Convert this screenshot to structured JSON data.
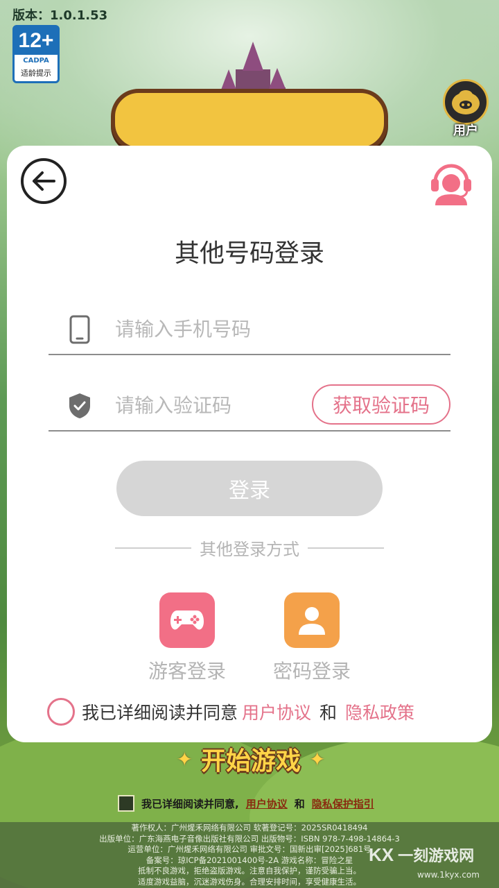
{
  "version": "版本：1.0.1.53",
  "age_badge": {
    "rating": "12+",
    "org": "CADPA",
    "tip": "适龄提示"
  },
  "user_button": {
    "label": "用户"
  },
  "dialog": {
    "title": "其他号码登录",
    "phone_placeholder": "请输入手机号码",
    "code_placeholder": "请输入验证码",
    "get_code_label": "获取验证码",
    "login_label": "登录",
    "other_methods_label": "其他登录方式",
    "guest_login_label": "游客登录",
    "password_login_label": "密码登录",
    "agreement": {
      "prefix": "我已详细阅读并同意",
      "user_agreement": "用户协议",
      "and": "和",
      "privacy_policy": "隐私政策"
    }
  },
  "start_game_label": "开始游戏",
  "bottom_agreement": {
    "prefix": "我已详细阅读并同意,",
    "user_agreement": "用户协议",
    "and": "和",
    "privacy_guide": "隐私保护指引"
  },
  "legal": [
    "著作权人：广州煋禾网络有限公司 软著登记号：2025SR0418494",
    "出版单位：广东海燕电子音像出版社有限公司 出版物号：ISBN 978-7-498-14864-3",
    "运营单位：广州煋禾网络有限公司 审批文号：国新出审[2025]681号",
    "备案号：琼ICP备2021001400号-2A 游戏名称：冒险之星",
    "抵制不良游戏，拒绝盗版游戏。注意自我保护，谨防受骗上当。",
    "适度游戏益脑，沉迷游戏伤身。合理安排时间，享受健康生活。"
  ],
  "watermark": {
    "mark": "KX",
    "name": "一刻游戏网",
    "url": "www.1kyx.com"
  },
  "colors": {
    "accent_pink": "#e4728a",
    "guest_tile": "#f26f86",
    "password_tile": "#f4a14a",
    "login_disabled": "#d6d6d6"
  }
}
